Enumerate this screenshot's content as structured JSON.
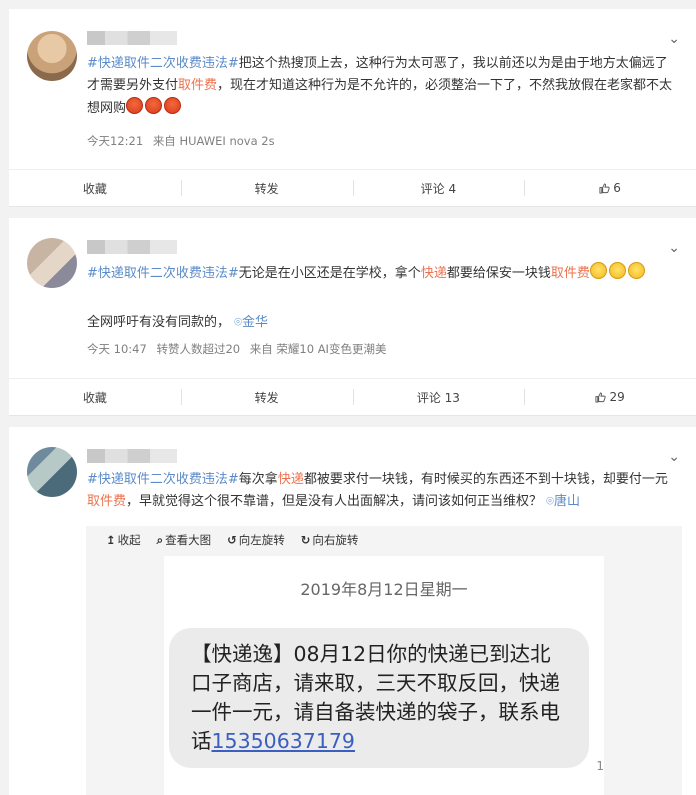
{
  "posts": [
    {
      "text_parts": [
        {
          "t": "#快递取件二次收费违法#",
          "c": "tag"
        },
        {
          "t": "把这个热搜顶上去，这种行为太可恶了，我以前还以为是由于地方太偏远了才需要另外支付",
          "c": ""
        },
        {
          "t": "取件费",
          "c": "link"
        },
        {
          "t": "，现在才知道这种行为是不允许的，必须整治一下了，不然我放假在老家都不太想网购",
          "c": ""
        }
      ],
      "meta_time": "今天12:21",
      "meta_from": "来自 HUAWEI nova 2s",
      "actions": {
        "collect": "收藏",
        "forward": "转发",
        "comment": "评论 4",
        "like": "6"
      }
    },
    {
      "text_parts": [
        {
          "t": "#快递取件二次收费违法#",
          "c": "tag"
        },
        {
          "t": "无论是在小区还是在学校，拿个",
          "c": ""
        },
        {
          "t": "快递",
          "c": "link"
        },
        {
          "t": "都要给保安一块钱",
          "c": ""
        },
        {
          "t": "取件费",
          "c": "link"
        }
      ],
      "line2": "全网呼吁有没有同款的，",
      "location": "金华",
      "meta_time": "今天 10:47",
      "meta_forward": "转赞人数超过20",
      "meta_from": "来自 荣耀10 AI变色更潮美",
      "actions": {
        "collect": "收藏",
        "forward": "转发",
        "comment": "评论 13",
        "like": "29"
      }
    },
    {
      "text_parts": [
        {
          "t": "#快递取件二次收费违法#",
          "c": "tag"
        },
        {
          "t": "每次拿",
          "c": ""
        },
        {
          "t": "快递",
          "c": "link"
        },
        {
          "t": "都被要求付一块钱，有时候买的东西还不到十块钱，却要付一元",
          "c": ""
        },
        {
          "t": "取件费",
          "c": "link"
        },
        {
          "t": "，早就觉得这个很不靠谱，但是没有人出面解决，请问该如何正当维权？",
          "c": ""
        }
      ],
      "location": "唐山",
      "viewer_toolbar": {
        "collapse": "收起",
        "view_large": "查看大图",
        "rotate_left": "向左旋转",
        "rotate_right": "向右旋转"
      },
      "sms": {
        "date": "2019年8月12日星期一",
        "body": "【快递逸】08月12日你的快递已到达北口子商店，请来取，三天不取反回，快递一件一元，请自备装快递的袋子，联系电话",
        "phone": "15350637179",
        "corner": "1"
      }
    }
  ],
  "colors": {
    "tag": "#5b8bc8",
    "link": "#eb7350",
    "background": "#f2f2f2"
  }
}
